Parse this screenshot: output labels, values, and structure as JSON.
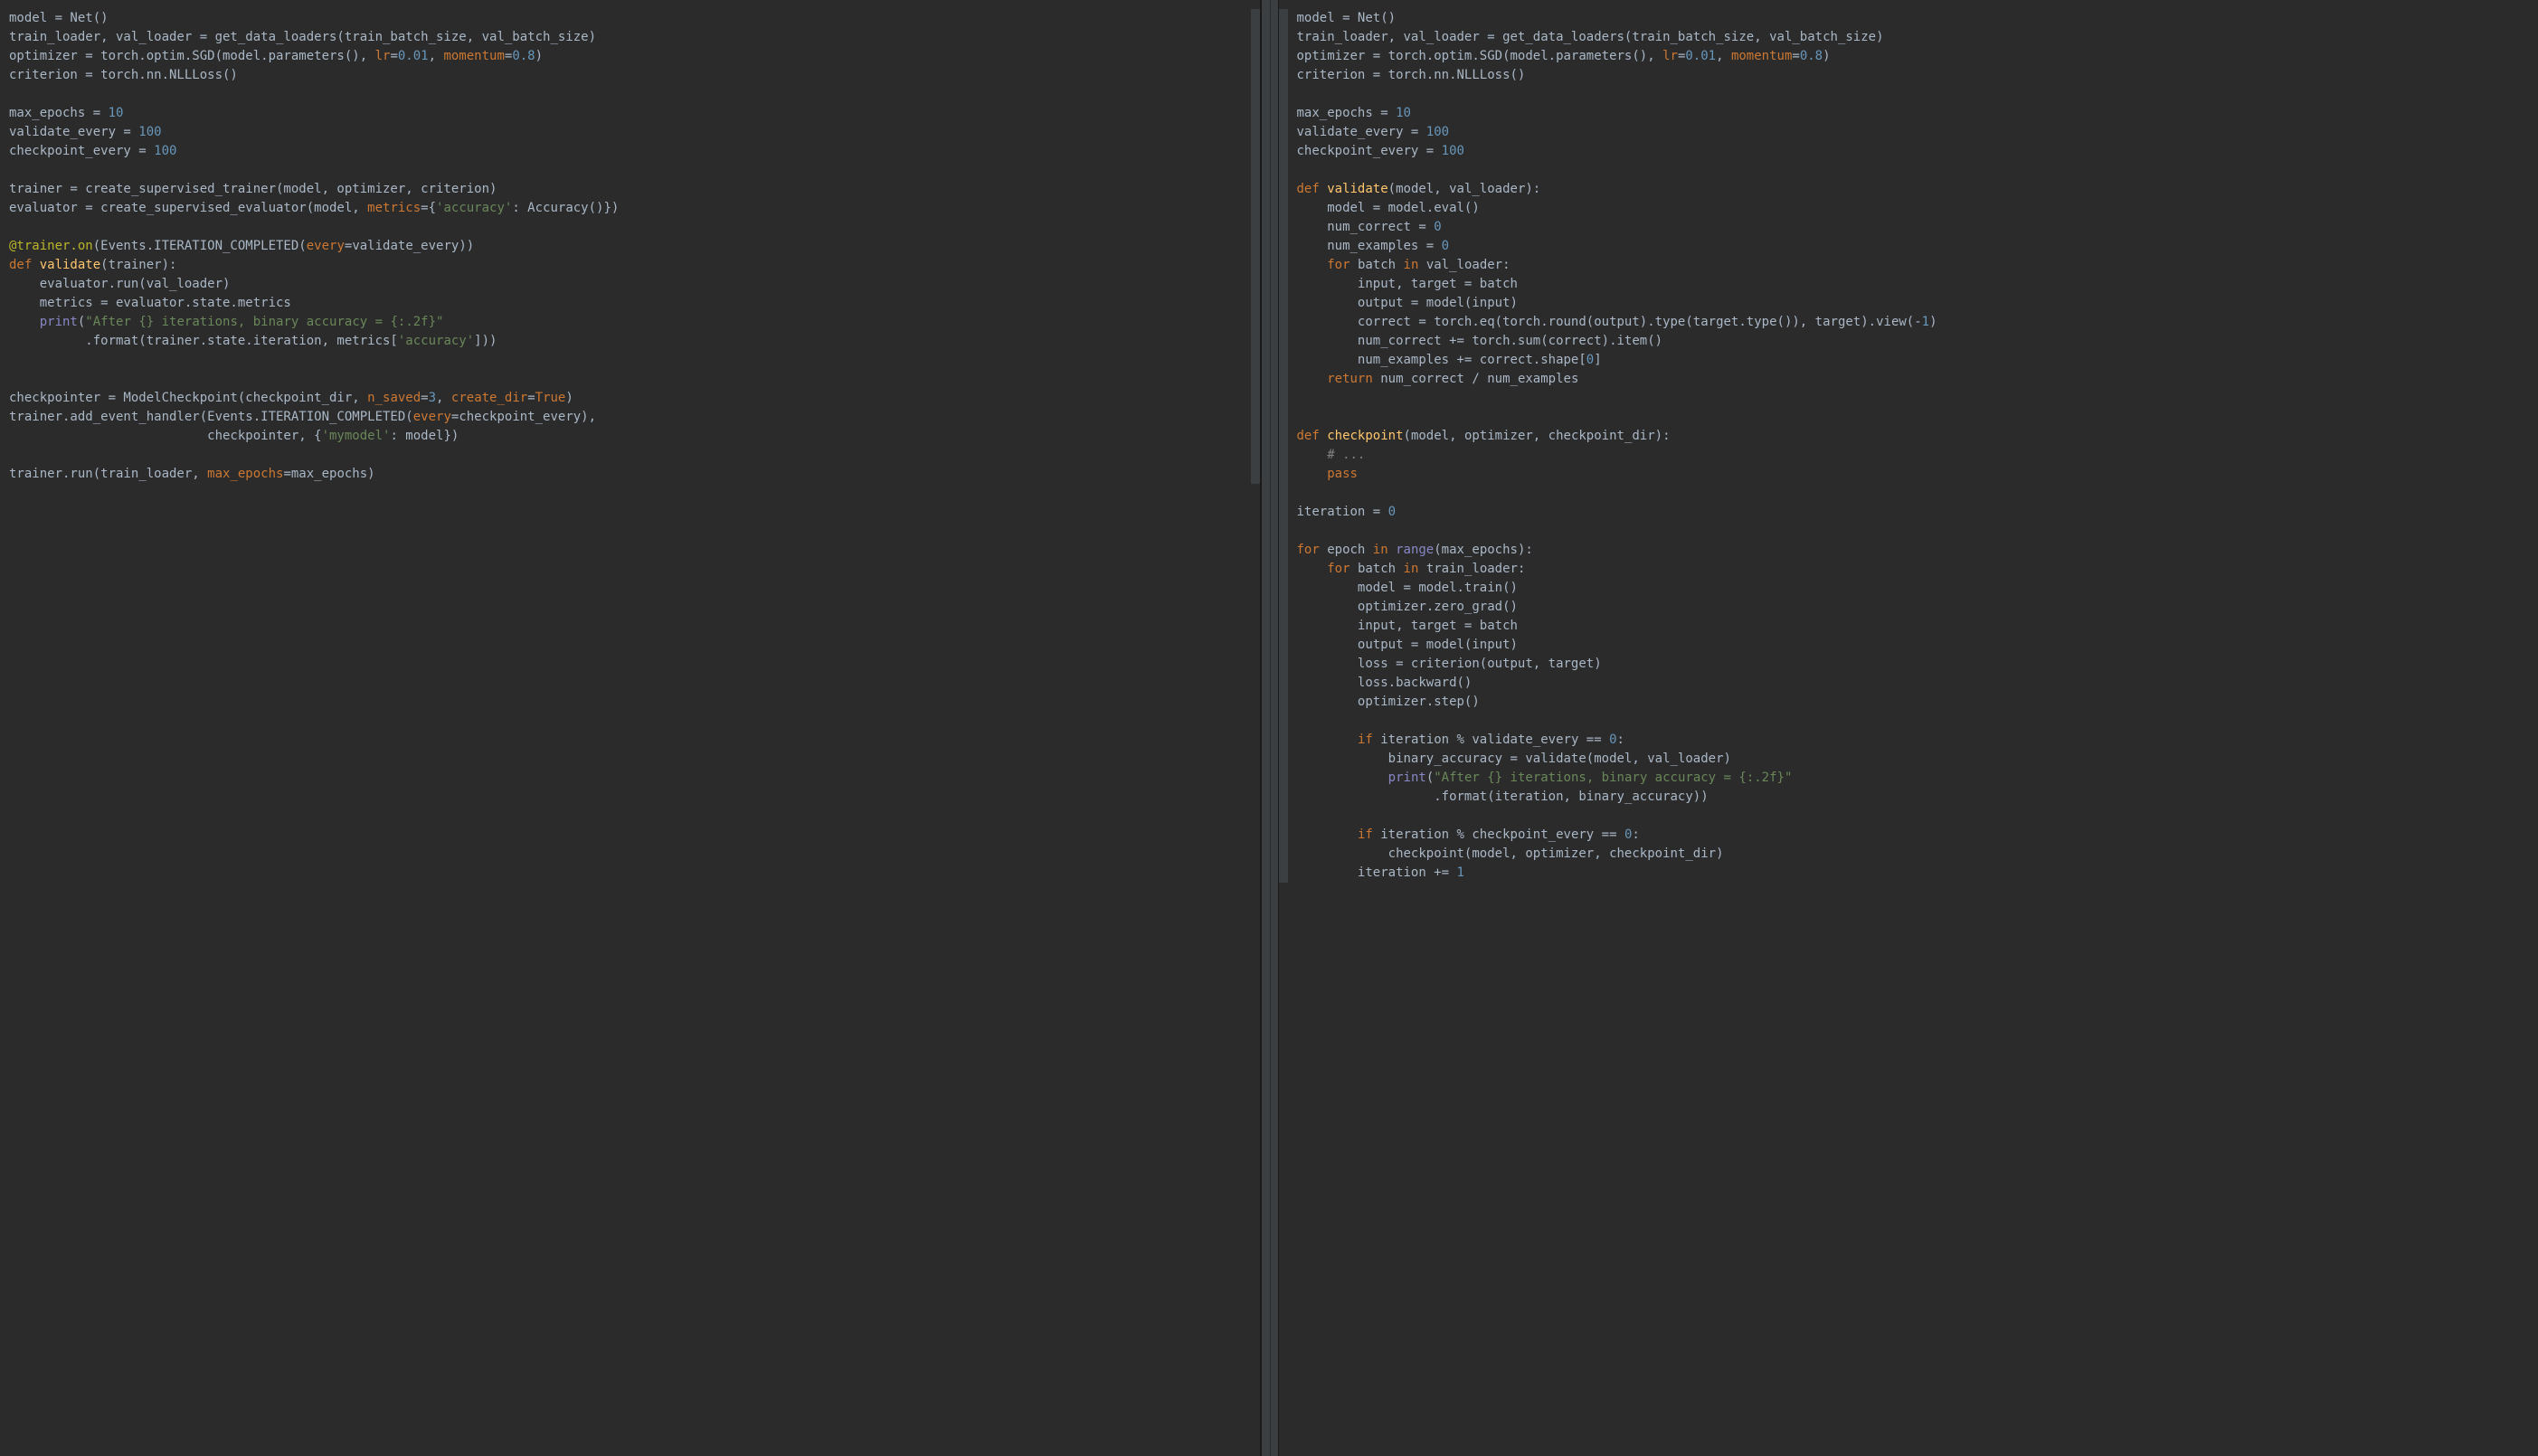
{
  "left_panel": {
    "lines": [
      [
        {
          "t": "model = Net()",
          "c": "default"
        }
      ],
      [
        {
          "t": "train_loader, val_loader = get_data_loaders(train_batch_size, val_batch_size)",
          "c": "default"
        }
      ],
      [
        {
          "t": "optimizer = torch.optim.SGD(model.parameters(), ",
          "c": "default"
        },
        {
          "t": "lr",
          "c": "param"
        },
        {
          "t": "=",
          "c": "default"
        },
        {
          "t": "0.01",
          "c": "number"
        },
        {
          "t": ", ",
          "c": "default"
        },
        {
          "t": "momentum",
          "c": "param"
        },
        {
          "t": "=",
          "c": "default"
        },
        {
          "t": "0.8",
          "c": "number"
        },
        {
          "t": ")",
          "c": "default"
        }
      ],
      [
        {
          "t": "criterion = torch.nn.NLLLoss()",
          "c": "default"
        }
      ],
      [],
      [
        {
          "t": "max_epochs = ",
          "c": "default"
        },
        {
          "t": "10",
          "c": "number"
        }
      ],
      [
        {
          "t": "validate_every = ",
          "c": "default"
        },
        {
          "t": "100",
          "c": "number"
        }
      ],
      [
        {
          "t": "checkpoint_every = ",
          "c": "default"
        },
        {
          "t": "100",
          "c": "number"
        }
      ],
      [],
      [
        {
          "t": "trainer = create_supervised_trainer(model, optimizer, criterion)",
          "c": "default"
        }
      ],
      [
        {
          "t": "evaluator = create_supervised_evaluator(model, ",
          "c": "default"
        },
        {
          "t": "metrics",
          "c": "param"
        },
        {
          "t": "={",
          "c": "default"
        },
        {
          "t": "'accuracy'",
          "c": "string"
        },
        {
          "t": ": Accuracy()})",
          "c": "default"
        }
      ],
      [],
      [
        {
          "t": "@trainer.on",
          "c": "decorator"
        },
        {
          "t": "(Events.ITERATION_COMPLETED(",
          "c": "default"
        },
        {
          "t": "every",
          "c": "param"
        },
        {
          "t": "=validate_every))",
          "c": "default"
        }
      ],
      [
        {
          "t": "def ",
          "c": "keyword"
        },
        {
          "t": "validate",
          "c": "def-name"
        },
        {
          "t": "(trainer):",
          "c": "default"
        }
      ],
      [
        {
          "t": "    evaluator.run(val_loader)",
          "c": "default"
        }
      ],
      [
        {
          "t": "    metrics = evaluator.state.metrics",
          "c": "default"
        }
      ],
      [
        {
          "t": "    ",
          "c": "default"
        },
        {
          "t": "print",
          "c": "builtin"
        },
        {
          "t": "(",
          "c": "default"
        },
        {
          "t": "\"After {} iterations, binary accuracy = {:.2f}\"",
          "c": "string"
        }
      ],
      [
        {
          "t": "          .format(trainer.state.iteration, metrics[",
          "c": "default"
        },
        {
          "t": "'accuracy'",
          "c": "string"
        },
        {
          "t": "]))",
          "c": "default"
        }
      ],
      [],
      [],
      [
        {
          "t": "checkpointer = ModelCheckpoint(checkpoint_dir, ",
          "c": "default"
        },
        {
          "t": "n_saved",
          "c": "param"
        },
        {
          "t": "=",
          "c": "default"
        },
        {
          "t": "3",
          "c": "number"
        },
        {
          "t": ", ",
          "c": "default"
        },
        {
          "t": "create_dir",
          "c": "param"
        },
        {
          "t": "=",
          "c": "default"
        },
        {
          "t": "True",
          "c": "keyword"
        },
        {
          "t": ")",
          "c": "default"
        }
      ],
      [
        {
          "t": "trainer.add_event_handler(Events.ITERATION_COMPLETED(",
          "c": "default"
        },
        {
          "t": "every",
          "c": "param"
        },
        {
          "t": "=checkpoint_every),",
          "c": "default"
        }
      ],
      [
        {
          "t": "                          checkpointer, {",
          "c": "default"
        },
        {
          "t": "'mymodel'",
          "c": "string"
        },
        {
          "t": ": model})",
          "c": "default"
        }
      ],
      [],
      [
        {
          "t": "trainer.run(train_loader, ",
          "c": "default"
        },
        {
          "t": "max_epochs",
          "c": "param"
        },
        {
          "t": "=max_epochs)",
          "c": "default"
        }
      ]
    ]
  },
  "right_panel": {
    "lines": [
      [
        {
          "t": "model = Net()",
          "c": "default"
        }
      ],
      [
        {
          "t": "train_loader, val_loader = get_data_loaders(train_batch_size, val_batch_size)",
          "c": "default"
        }
      ],
      [
        {
          "t": "optimizer = torch.optim.SGD(model.parameters(), ",
          "c": "default"
        },
        {
          "t": "lr",
          "c": "param"
        },
        {
          "t": "=",
          "c": "default"
        },
        {
          "t": "0.01",
          "c": "number"
        },
        {
          "t": ", ",
          "c": "default"
        },
        {
          "t": "momentum",
          "c": "param"
        },
        {
          "t": "=",
          "c": "default"
        },
        {
          "t": "0.8",
          "c": "number"
        },
        {
          "t": ")",
          "c": "default"
        }
      ],
      [
        {
          "t": "criterion = torch.nn.NLLLoss()",
          "c": "default"
        }
      ],
      [],
      [
        {
          "t": "max_epochs = ",
          "c": "default"
        },
        {
          "t": "10",
          "c": "number"
        }
      ],
      [
        {
          "t": "validate_every = ",
          "c": "default"
        },
        {
          "t": "100",
          "c": "number"
        }
      ],
      [
        {
          "t": "checkpoint_every = ",
          "c": "default"
        },
        {
          "t": "100",
          "c": "number"
        }
      ],
      [],
      [
        {
          "t": "def ",
          "c": "keyword"
        },
        {
          "t": "validate",
          "c": "def-name"
        },
        {
          "t": "(model, val_loader):",
          "c": "default"
        }
      ],
      [
        {
          "t": "    model = model.eval()",
          "c": "default"
        }
      ],
      [
        {
          "t": "    num_correct = ",
          "c": "default"
        },
        {
          "t": "0",
          "c": "number"
        }
      ],
      [
        {
          "t": "    num_examples = ",
          "c": "default"
        },
        {
          "t": "0",
          "c": "number"
        }
      ],
      [
        {
          "t": "    ",
          "c": "default"
        },
        {
          "t": "for ",
          "c": "keyword"
        },
        {
          "t": "batch ",
          "c": "default"
        },
        {
          "t": "in ",
          "c": "keyword"
        },
        {
          "t": "val_loader:",
          "c": "default"
        }
      ],
      [
        {
          "t": "        input, target = batch",
          "c": "default"
        }
      ],
      [
        {
          "t": "        output = model(input)",
          "c": "default"
        }
      ],
      [
        {
          "t": "        correct = torch.eq(torch.round(output).type(target.type()), target).view(-",
          "c": "default"
        },
        {
          "t": "1",
          "c": "number"
        },
        {
          "t": ")",
          "c": "default"
        }
      ],
      [
        {
          "t": "        num_correct += torch.sum(correct).item()",
          "c": "default"
        }
      ],
      [
        {
          "t": "        num_examples += correct.shape[",
          "c": "default"
        },
        {
          "t": "0",
          "c": "number"
        },
        {
          "t": "]",
          "c": "default"
        }
      ],
      [
        {
          "t": "    ",
          "c": "default"
        },
        {
          "t": "return ",
          "c": "keyword"
        },
        {
          "t": "num_correct / num_examples",
          "c": "default"
        }
      ],
      [],
      [],
      [
        {
          "t": "def ",
          "c": "keyword"
        },
        {
          "t": "checkpoint",
          "c": "def-name"
        },
        {
          "t": "(model, optimizer, checkpoint_dir):",
          "c": "default"
        }
      ],
      [
        {
          "t": "    ",
          "c": "default"
        },
        {
          "t": "# ...",
          "c": "comment"
        }
      ],
      [
        {
          "t": "    ",
          "c": "default"
        },
        {
          "t": "pass",
          "c": "keyword"
        }
      ],
      [],
      [
        {
          "t": "iteration = ",
          "c": "default"
        },
        {
          "t": "0",
          "c": "number"
        }
      ],
      [],
      [
        {
          "t": "for ",
          "c": "keyword"
        },
        {
          "t": "epoch ",
          "c": "default"
        },
        {
          "t": "in ",
          "c": "keyword"
        },
        {
          "t": "range",
          "c": "builtin"
        },
        {
          "t": "(max_epochs):",
          "c": "default"
        }
      ],
      [
        {
          "t": "    ",
          "c": "default"
        },
        {
          "t": "for ",
          "c": "keyword"
        },
        {
          "t": "batch ",
          "c": "default"
        },
        {
          "t": "in ",
          "c": "keyword"
        },
        {
          "t": "train_loader:",
          "c": "default"
        }
      ],
      [
        {
          "t": "        model = model.train()",
          "c": "default"
        }
      ],
      [
        {
          "t": "        optimizer.zero_grad()",
          "c": "default"
        }
      ],
      [
        {
          "t": "        input, target = batch",
          "c": "default"
        }
      ],
      [
        {
          "t": "        output = model(input)",
          "c": "default"
        }
      ],
      [
        {
          "t": "        loss = criterion(output, target)",
          "c": "default"
        }
      ],
      [
        {
          "t": "        loss.backward()",
          "c": "default"
        }
      ],
      [
        {
          "t": "        optimizer.step()",
          "c": "default"
        }
      ],
      [],
      [
        {
          "t": "        ",
          "c": "default"
        },
        {
          "t": "if ",
          "c": "keyword"
        },
        {
          "t": "iteration % validate_every == ",
          "c": "default"
        },
        {
          "t": "0",
          "c": "number"
        },
        {
          "t": ":",
          "c": "default"
        }
      ],
      [
        {
          "t": "            binary_accuracy = validate(model, val_loader)",
          "c": "default"
        }
      ],
      [
        {
          "t": "            ",
          "c": "default"
        },
        {
          "t": "print",
          "c": "builtin"
        },
        {
          "t": "(",
          "c": "default"
        },
        {
          "t": "\"After {} iterations, binary accuracy = {:.2f}\"",
          "c": "string"
        }
      ],
      [
        {
          "t": "                  .format(iteration, binary_accuracy))",
          "c": "default"
        }
      ],
      [],
      [
        {
          "t": "        ",
          "c": "default"
        },
        {
          "t": "if ",
          "c": "keyword"
        },
        {
          "t": "iteration % checkpoint_every == ",
          "c": "default"
        },
        {
          "t": "0",
          "c": "number"
        },
        {
          "t": ":",
          "c": "default"
        }
      ],
      [
        {
          "t": "            checkpoint(model, optimizer, checkpoint_dir)",
          "c": "default"
        }
      ],
      [
        {
          "t": "        iteration += ",
          "c": "default"
        },
        {
          "t": "1",
          "c": "number"
        }
      ]
    ]
  }
}
